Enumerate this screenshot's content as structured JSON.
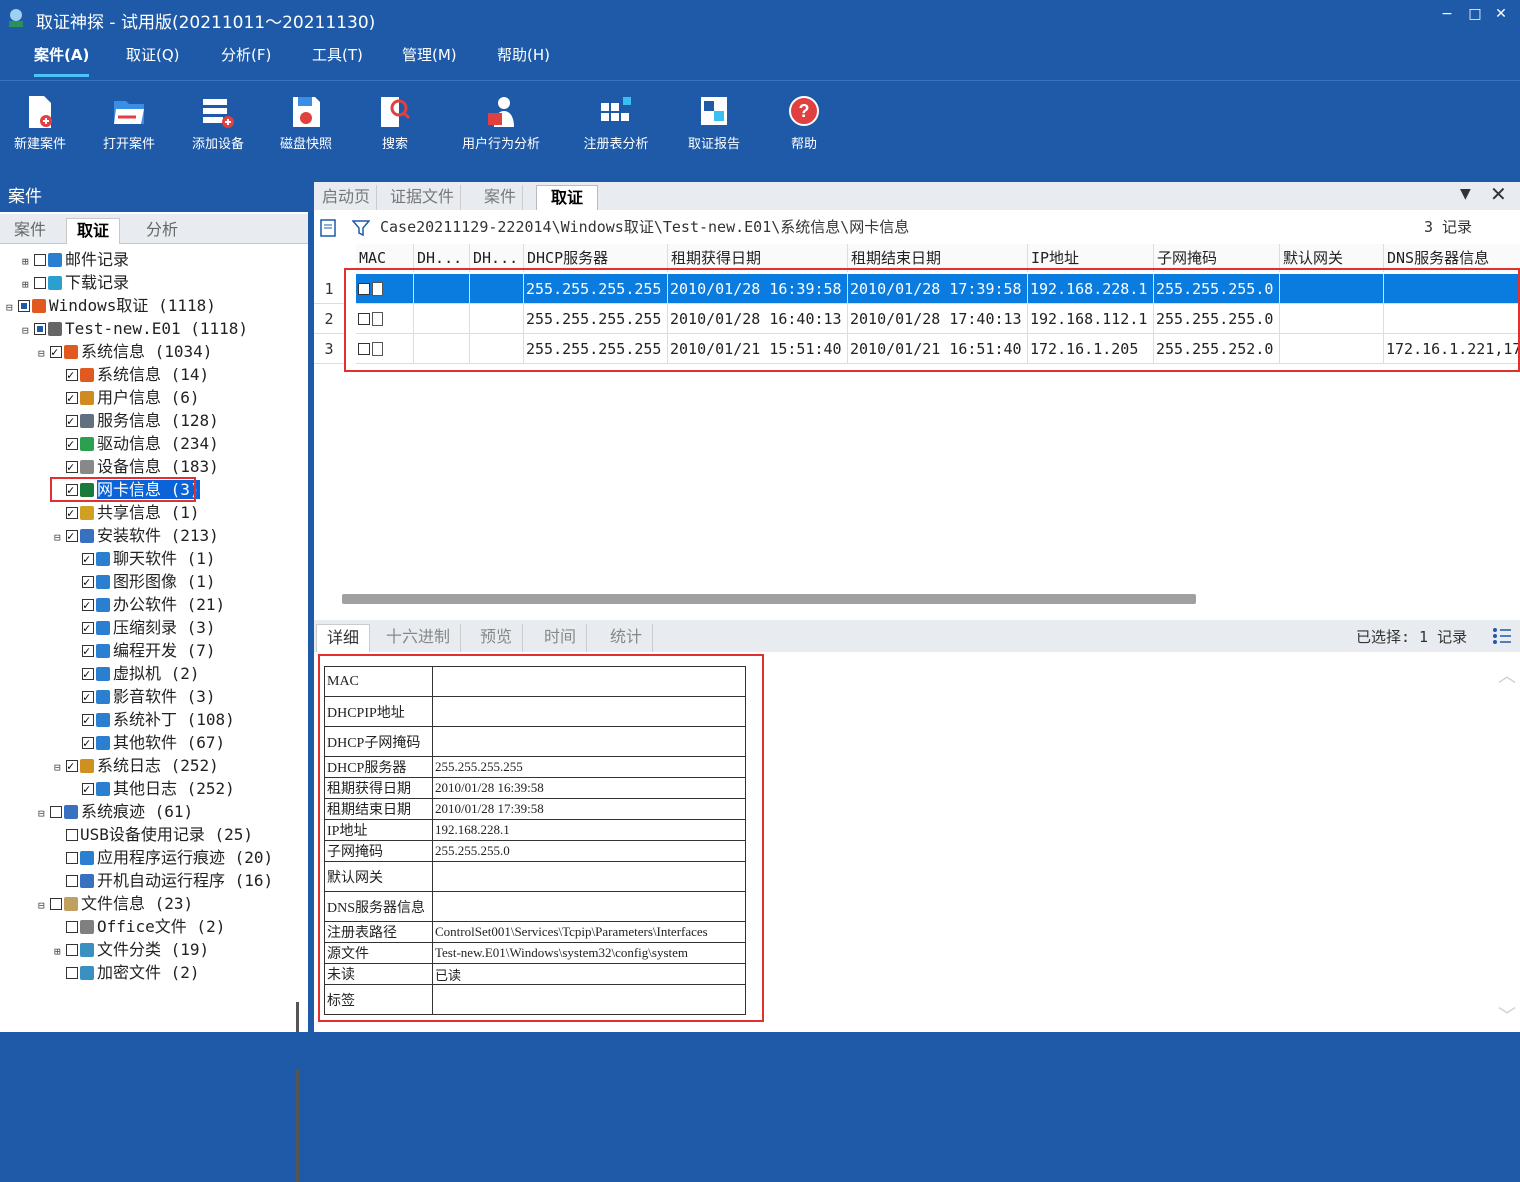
{
  "window": {
    "title": "取证神探 - 试用版(20211011～20211130)",
    "min": "−",
    "max": "□",
    "close": "✕"
  },
  "menu": [
    "案件(A)",
    "取证(Q)",
    "分析(F)",
    "工具(T)",
    "管理(M)",
    "帮助(H)"
  ],
  "toolbar": [
    "新建案件",
    "打开案件",
    "添加设备",
    "磁盘快照",
    "搜索",
    "用户行为分析",
    "注册表分析",
    "取证报告",
    "帮助"
  ],
  "left": {
    "header": "案件",
    "tabs": [
      "案件",
      "取证",
      "分析"
    ],
    "tree": [
      {
        "label": "邮件记录",
        "level": 1,
        "exp": "+",
        "cb": "",
        "icon": "mail"
      },
      {
        "label": "下载记录",
        "level": 1,
        "exp": "+",
        "cb": "",
        "icon": "down"
      },
      {
        "label": "Windows取证 (1118)",
        "level": 0,
        "exp": "−",
        "cb": "part",
        "icon": "win"
      },
      {
        "label": "Test-new.E01 (1118)",
        "level": 1,
        "exp": "−",
        "cb": "part",
        "icon": "disk"
      },
      {
        "label": "系统信息 (1034)",
        "level": 2,
        "exp": "−",
        "cb": "chk",
        "icon": "win"
      },
      {
        "label": "系统信息 (14)",
        "level": 3,
        "exp": "",
        "cb": "chk",
        "icon": "win"
      },
      {
        "label": "用户信息 (6)",
        "level": 3,
        "exp": "",
        "cb": "chk",
        "icon": "users"
      },
      {
        "label": "服务信息 (128)",
        "level": 3,
        "exp": "",
        "cb": "chk",
        "icon": "svc"
      },
      {
        "label": "驱动信息 (234)",
        "level": 3,
        "exp": "",
        "cb": "chk",
        "icon": "drv"
      },
      {
        "label": "设备信息 (183)",
        "level": 3,
        "exp": "",
        "cb": "chk",
        "icon": "dev"
      },
      {
        "label": "网卡信息 (3)",
        "level": 3,
        "exp": "",
        "cb": "chk",
        "icon": "nic",
        "sel": true
      },
      {
        "label": "共享信息 (1)",
        "level": 3,
        "exp": "",
        "cb": "chk",
        "icon": "share"
      },
      {
        "label": "安装软件 (213)",
        "level": 3,
        "exp": "−",
        "cb": "chk",
        "icon": "soft"
      },
      {
        "label": "聊天软件 (1)",
        "level": 4,
        "exp": "",
        "cb": "chk",
        "icon": "file"
      },
      {
        "label": "图形图像 (1)",
        "level": 4,
        "exp": "",
        "cb": "chk",
        "icon": "file"
      },
      {
        "label": "办公软件 (21)",
        "level": 4,
        "exp": "",
        "cb": "chk",
        "icon": "file"
      },
      {
        "label": "压缩刻录 (3)",
        "level": 4,
        "exp": "",
        "cb": "chk",
        "icon": "file"
      },
      {
        "label": "编程开发 (7)",
        "level": 4,
        "exp": "",
        "cb": "chk",
        "icon": "file"
      },
      {
        "label": "虚拟机 (2)",
        "level": 4,
        "exp": "",
        "cb": "chk",
        "icon": "file"
      },
      {
        "label": "影音软件 (3)",
        "level": 4,
        "exp": "",
        "cb": "chk",
        "icon": "file"
      },
      {
        "label": "系统补丁 (108)",
        "level": 4,
        "exp": "",
        "cb": "chk",
        "icon": "file"
      },
      {
        "label": "其他软件 (67)",
        "level": 4,
        "exp": "",
        "cb": "chk",
        "icon": "file"
      },
      {
        "label": "系统日志 (252)",
        "level": 3,
        "exp": "−",
        "cb": "chk",
        "icon": "log"
      },
      {
        "label": "其他日志 (252)",
        "level": 4,
        "exp": "",
        "cb": "chk",
        "icon": "file"
      },
      {
        "label": "系统痕迹 (61)",
        "level": 2,
        "exp": "−",
        "cb": "",
        "icon": "user"
      },
      {
        "label": "USB设备使用记录 (25)",
        "level": 3,
        "exp": "",
        "cb": "",
        "icon": "none"
      },
      {
        "label": "应用程序运行痕迹 (20)",
        "level": 3,
        "exp": "",
        "cb": "",
        "icon": "app"
      },
      {
        "label": "开机自动运行程序 (16)",
        "level": 3,
        "exp": "",
        "cb": "",
        "icon": "run"
      },
      {
        "label": "文件信息 (23)",
        "level": 2,
        "exp": "−",
        "cb": "",
        "icon": "folder"
      },
      {
        "label": "Office文件 (2)",
        "level": 3,
        "exp": "",
        "cb": "",
        "icon": "office"
      },
      {
        "label": "文件分类 (19)",
        "level": 3,
        "exp": "+",
        "cb": "",
        "icon": "cat"
      },
      {
        "label": "加密文件 (2)",
        "level": 3,
        "exp": "",
        "cb": "",
        "icon": "lock"
      }
    ]
  },
  "main": {
    "tabs": [
      "启动页",
      "证据文件",
      "案件",
      "取证"
    ],
    "path": "Case20211129-222014\\Windows取证\\Test-new.E01\\系统信息\\网卡信息",
    "record_count": "3 记录",
    "columns": [
      "MAC",
      "DH...",
      "DH...",
      "DHCP服务器",
      "租期获得日期",
      "租期结束日期",
      "IP地址",
      "子网掩码",
      "默认网关",
      "DNS服务器信息"
    ],
    "rows": [
      [
        "1",
        "",
        "",
        "",
        "255.255.255.255",
        "2010/01/28 16:39:58",
        "2010/01/28 17:39:58",
        "192.168.228.1",
        "255.255.255.0",
        "",
        ""
      ],
      [
        "2",
        "",
        "",
        "",
        "255.255.255.255",
        "2010/01/28 16:40:13",
        "2010/01/28 17:40:13",
        "192.168.112.1",
        "255.255.255.0",
        "",
        ""
      ],
      [
        "3",
        "",
        "",
        "",
        "255.255.255.255",
        "2010/01/21 15:51:40",
        "2010/01/21 16:51:40",
        "172.16.1.205",
        "255.255.252.0",
        "",
        "172.16.1.221,17"
      ]
    ],
    "bottom_tabs": [
      "详细",
      "十六进制",
      "预览",
      "时间",
      "统计"
    ],
    "selected": "已选择: 1 记录",
    "detail": [
      [
        "MAC",
        ""
      ],
      [
        "DHCPIP地址",
        ""
      ],
      [
        "DHCP子网掩码",
        ""
      ],
      [
        "DHCP服务器",
        "255.255.255.255"
      ],
      [
        "租期获得日期",
        "2010/01/28 16:39:58"
      ],
      [
        "租期结束日期",
        "2010/01/28 17:39:58"
      ],
      [
        "IP地址",
        "192.168.228.1"
      ],
      [
        "子网掩码",
        "255.255.255.0"
      ],
      [
        "默认网关",
        ""
      ],
      [
        "DNS服务器信息",
        ""
      ],
      [
        "注册表路径",
        "ControlSet001\\Services\\Tcpip\\Parameters\\Interfaces"
      ],
      [
        "源文件",
        "Test-new.E01\\Windows\\system32\\config\\system"
      ],
      [
        "未读",
        "已读"
      ],
      [
        "标签",
        ""
      ]
    ]
  }
}
